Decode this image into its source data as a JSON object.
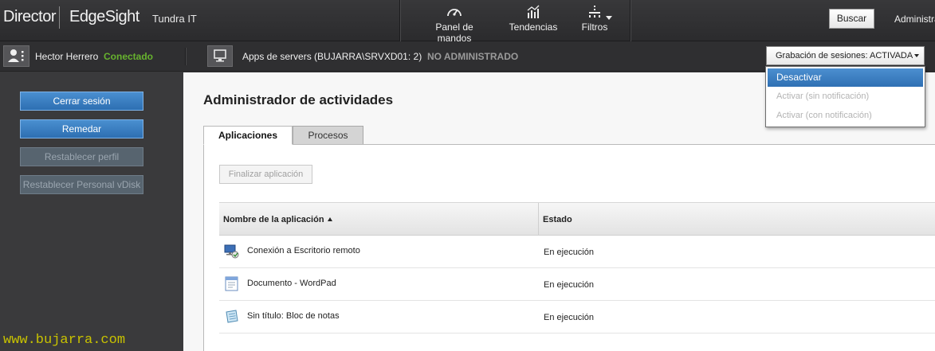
{
  "header": {
    "brand_primary": "Director",
    "brand_secondary": "EdgeSight",
    "tenant": "Tundra IT",
    "nav": [
      {
        "label": "Panel de mandos",
        "icon": "dashboard-icon"
      },
      {
        "label": "Tendencias",
        "icon": "trends-icon"
      },
      {
        "label": "Filtros",
        "icon": "filters-icon"
      }
    ],
    "search_label": "Buscar",
    "admin_label": "Administra"
  },
  "session_bar": {
    "user_name": "Hector Herrero",
    "user_status": "Conectado",
    "machine": "Apps de servers (BUJARRA\\SRVXD01: 2)",
    "machine_state": "NO ADMINISTRADO",
    "recording_label": "Grabación de sesiones: ACTIVADA",
    "recording_menu": [
      {
        "label": "Desactivar",
        "enabled": true,
        "selected": true
      },
      {
        "label": "Activar (sin notificación)",
        "enabled": false
      },
      {
        "label": "Activar (con notificación)",
        "enabled": false
      }
    ]
  },
  "sidebar": {
    "buttons": [
      {
        "label": "Cerrar sesión",
        "enabled": true
      },
      {
        "label": "Remedar",
        "enabled": true
      },
      {
        "label": "Restablecer perfil",
        "enabled": false
      },
      {
        "label": "Restablecer Personal vDisk",
        "enabled": false
      }
    ],
    "watermark": "www.bujarra.com"
  },
  "main": {
    "title": "Administrador de actividades",
    "tabs": [
      {
        "label": "Aplicaciones",
        "active": true
      },
      {
        "label": "Procesos",
        "active": false
      }
    ],
    "end_app_label": "Finalizar aplicación",
    "table": {
      "columns": [
        "Nombre de la aplicación",
        "Estado"
      ],
      "rows": [
        {
          "name": "Conexión a Escritorio remoto",
          "state": "En ejecución",
          "icon": "remote-desktop-icon"
        },
        {
          "name": "Documento - WordPad",
          "state": "En ejecución",
          "icon": "wordpad-icon"
        },
        {
          "name": "Sin título: Bloc de notas",
          "state": "En ejecución",
          "icon": "notepad-icon"
        }
      ]
    }
  },
  "colors": {
    "accent_blue": "#2d6fb2",
    "status_green": "#67b32e",
    "watermark_yellow": "#c8c200"
  }
}
